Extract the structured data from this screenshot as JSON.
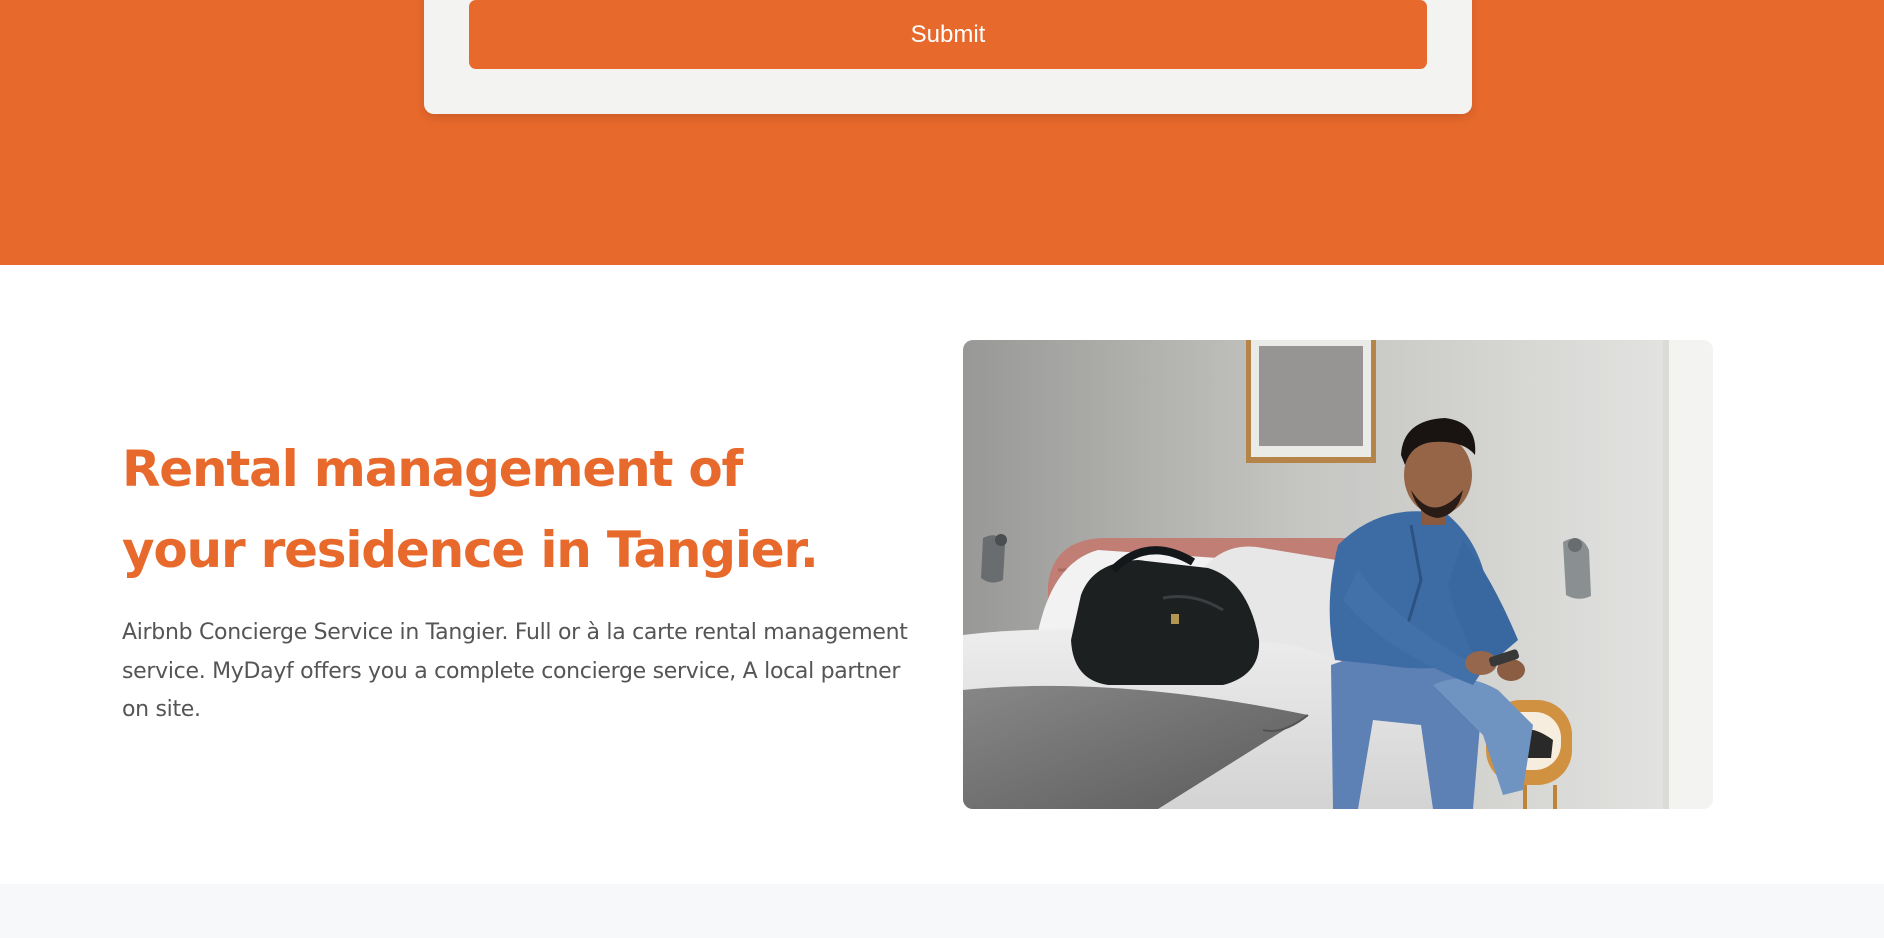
{
  "form": {
    "submit_label": "Submit"
  },
  "intro": {
    "heading": "Rental management of your residence in Tangier.",
    "description": "Airbnb Concierge Service in Tangier. Full or à la carte rental management service. MyDayf offers you a complete concierge service, A local partner on site."
  },
  "colors": {
    "brand_orange": "#e8692c",
    "form_card_bg": "#f3f3f2",
    "heading_color": "#e8692c",
    "text_gray": "#555555",
    "footer_bg": "#f7f8fa"
  }
}
